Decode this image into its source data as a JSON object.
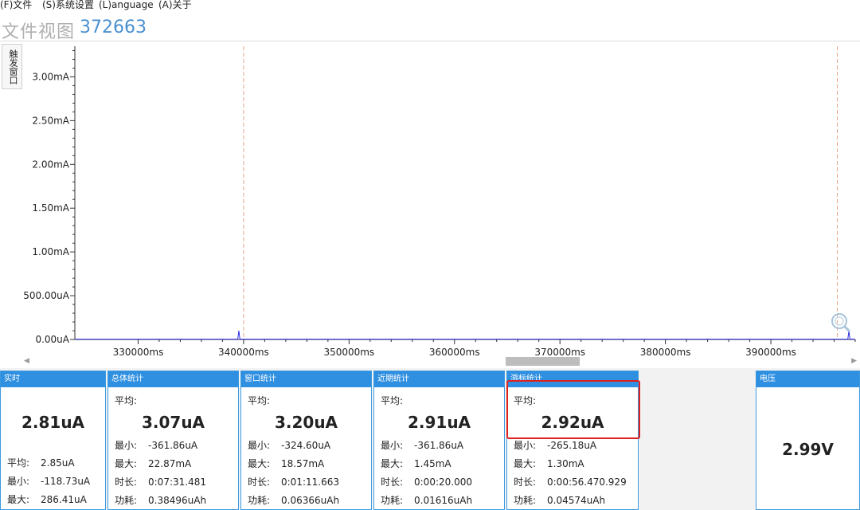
{
  "menu": [
    {
      "label": "(F)文件"
    },
    {
      "label": "(S)系统设置"
    },
    {
      "label": "(L)anguage"
    },
    {
      "label": "(A)关于"
    }
  ],
  "title": {
    "label": "文件视图",
    "id": "372663"
  },
  "trigger_button": "触发窗口",
  "chart_data": {
    "type": "line",
    "title": "",
    "xlabel": "",
    "ylabel": "",
    "x_unit": "ms",
    "xlim": [
      324000,
      398000
    ],
    "ylim": [
      0,
      3.35
    ],
    "y_unit": "mA",
    "x_ticks": [
      "330000ms",
      "340000ms",
      "350000ms",
      "360000ms",
      "370000ms",
      "380000ms",
      "390000ms"
    ],
    "x_tick_values": [
      330000,
      340000,
      350000,
      360000,
      370000,
      380000,
      390000
    ],
    "y_ticks": [
      "0.00uA",
      "500.00uA",
      "1.00mA",
      "1.50mA",
      "2.00mA",
      "2.50mA",
      "3.00mA"
    ],
    "y_tick_values": [
      0,
      0.5,
      1.0,
      1.5,
      2.0,
      2.5,
      3.0
    ],
    "series": [
      {
        "x": [
          324000,
          339450,
          339550,
          339650,
          397300,
          397400,
          397500,
          398000
        ],
        "y": [
          0.003,
          0.003,
          0.1,
          0.003,
          0.003,
          0.1,
          0.003,
          0.003
        ]
      }
    ],
    "markers_x": [
      340000,
      396300
    ],
    "grid": false,
    "colors": {
      "line": "#2a2ae6",
      "marker": "#e8a58a"
    }
  },
  "panels": [
    {
      "header": "实时",
      "big": "2.81uA",
      "rows": [
        {
          "k": "平均:",
          "v": "2.85uA"
        },
        {
          "k": "最小:",
          "v": "-118.73uA"
        },
        {
          "k": "最大:",
          "v": "286.41uA"
        }
      ]
    },
    {
      "header": "总体统计",
      "avg_label": "平均:",
      "big": "3.07uA",
      "rows": [
        {
          "k": "最小:",
          "v": "-361.86uA"
        },
        {
          "k": "最大:",
          "v": "22.87mA"
        },
        {
          "k": "时长:",
          "v": "0:07:31.481"
        },
        {
          "k": "功耗:",
          "v": "0.38496uAh"
        }
      ]
    },
    {
      "header": "窗口统计",
      "avg_label": "平均:",
      "big": "3.20uA",
      "rows": [
        {
          "k": "最小:",
          "v": "-324.60uA"
        },
        {
          "k": "最大:",
          "v": "18.57mA"
        },
        {
          "k": "时长:",
          "v": "0:01:11.663"
        },
        {
          "k": "功耗:",
          "v": "0.06366uAh"
        }
      ]
    },
    {
      "header": "近期统计",
      "avg_label": "平均:",
      "big": "2.91uA",
      "rows": [
        {
          "k": "最小:",
          "v": "-361.86uA"
        },
        {
          "k": "最大:",
          "v": "1.45mA"
        },
        {
          "k": "时长:",
          "v": "0:00:20.000"
        },
        {
          "k": "功耗:",
          "v": "0.01616uAh"
        }
      ]
    },
    {
      "header": "游标统计",
      "avg_label": "平均:",
      "big": "2.92uA",
      "rows": [
        {
          "k": "最小:",
          "v": "-265.18uA"
        },
        {
          "k": "最大:",
          "v": "1.30mA"
        },
        {
          "k": "时长:",
          "v": "0:00:56.470.929"
        },
        {
          "k": "功耗:",
          "v": "0.04574uAh"
        }
      ]
    },
    {
      "header": "电压",
      "big": "2.99V"
    }
  ],
  "colors": {
    "accent": "#2f8fe0",
    "highlight": "#e0201e",
    "title_id": "#4a90d0"
  }
}
